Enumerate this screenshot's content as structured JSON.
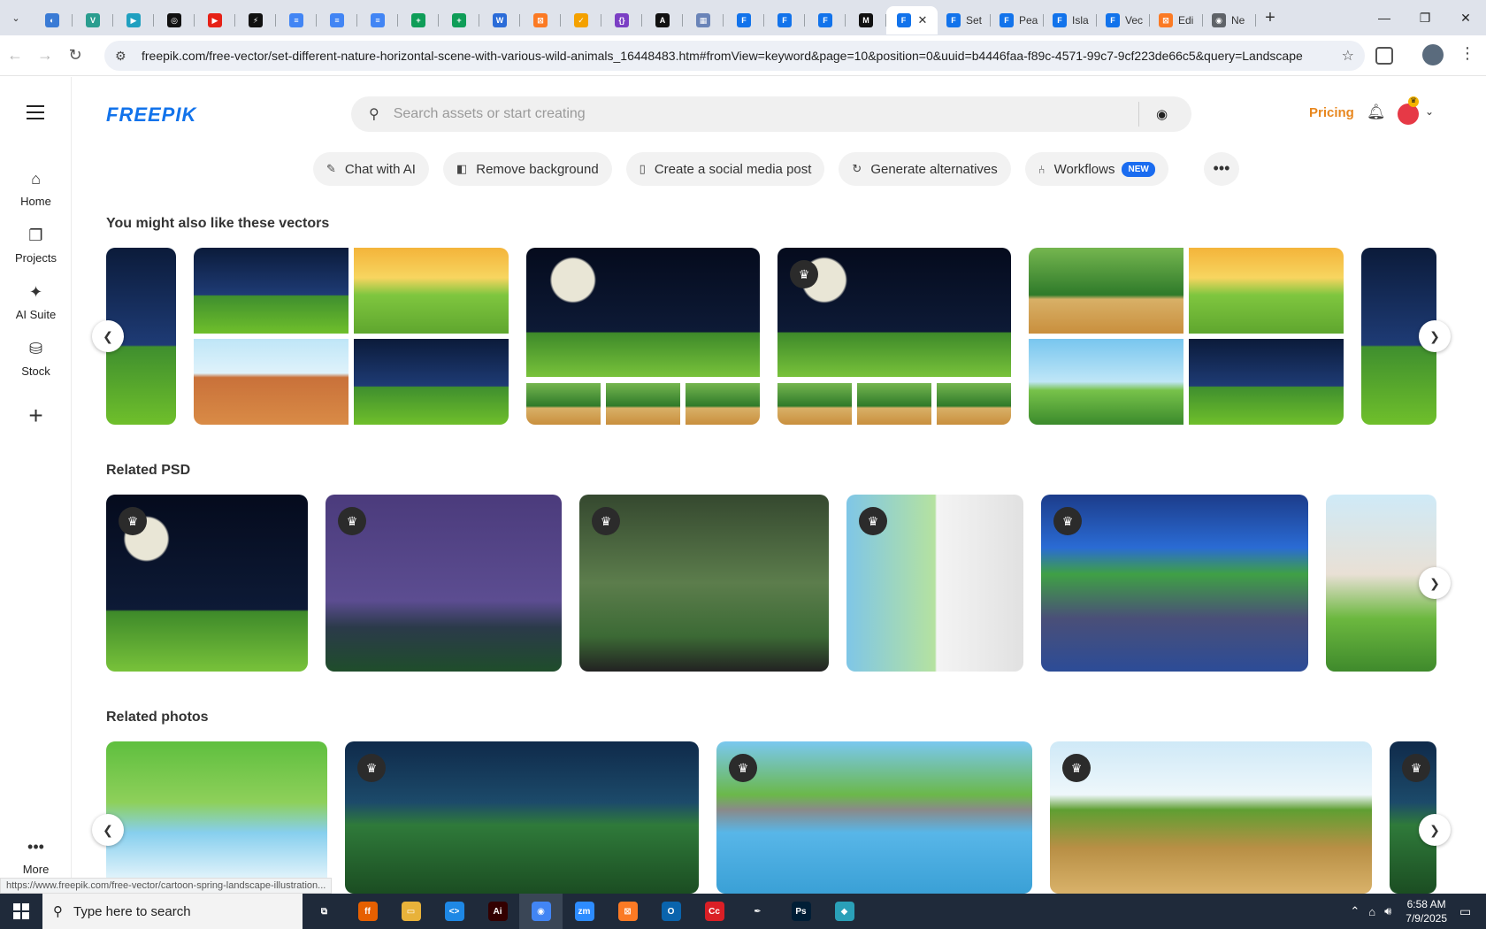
{
  "browser": {
    "tabs": [
      {
        "icon": "globe-icon",
        "color": "#3a7bd5",
        "letter": "◐"
      },
      {
        "icon": "v-icon",
        "color": "#2a9d8f",
        "letter": "V"
      },
      {
        "icon": "arrow-icon",
        "color": "#20a0c0",
        "letter": "▶"
      },
      {
        "icon": "openai-icon",
        "color": "#111111",
        "letter": "◎"
      },
      {
        "icon": "youtube-icon",
        "color": "#e62117",
        "letter": "▶"
      },
      {
        "icon": "bolt-icon",
        "color": "#111111",
        "letter": "⚡"
      },
      {
        "icon": "docs-icon",
        "color": "#4285f4",
        "letter": "≡"
      },
      {
        "icon": "docs-icon",
        "color": "#4285f4",
        "letter": "≡"
      },
      {
        "icon": "docs-icon",
        "color": "#4285f4",
        "letter": "≡"
      },
      {
        "icon": "sheets-icon",
        "color": "#0f9d58",
        "letter": "+"
      },
      {
        "icon": "sheets-icon",
        "color": "#0f9d58",
        "letter": "+"
      },
      {
        "icon": "word-icon",
        "color": "#2b6cd8",
        "letter": "W"
      },
      {
        "icon": "xampp-icon",
        "color": "#fb7a24",
        "letter": "⊠"
      },
      {
        "icon": "check-icon",
        "color": "#f4a100",
        "letter": "✓"
      },
      {
        "icon": "code-icon",
        "color": "#7b3fc4",
        "letter": "{}"
      },
      {
        "icon": "a-icon",
        "color": "#111111",
        "letter": "A"
      },
      {
        "icon": "grid-icon",
        "color": "#6a84b8",
        "letter": "▦"
      },
      {
        "icon": "freepik-icon",
        "color": "#1273eb",
        "letter": "F"
      },
      {
        "icon": "freepik-icon",
        "color": "#1273eb",
        "letter": "F"
      },
      {
        "icon": "freepik-icon",
        "color": "#1273eb",
        "letter": "F"
      },
      {
        "icon": "m-icon",
        "color": "#111111",
        "letter": "M"
      }
    ],
    "titled_tabs": [
      {
        "title": "Set",
        "color": "#1273eb",
        "letter": "F"
      },
      {
        "title": "Pea",
        "color": "#1273eb",
        "letter": "F"
      },
      {
        "title": "Isla",
        "color": "#1273eb",
        "letter": "F"
      },
      {
        "title": "Vec",
        "color": "#1273eb",
        "letter": "F"
      },
      {
        "title": "Edi",
        "color": "#fb7a24",
        "letter": "⊠"
      },
      {
        "title": "Ne",
        "color": "#5f6368",
        "letter": "◉"
      }
    ],
    "url": "freepik.com/free-vector/set-different-nature-horizontal-scene-with-various-wild-animals_16448483.htm#fromView=keyword&page=10&position=0&uuid=b4446faa-f89c-4571-99c7-9cf223de66c5&query=Landscape"
  },
  "sidebar": {
    "items": [
      {
        "label": "Home",
        "icon": "home-icon",
        "glyph": "⌂"
      },
      {
        "label": "Projects",
        "icon": "projects-icon",
        "glyph": "❐"
      },
      {
        "label": "AI Suite",
        "icon": "sparkle-icon",
        "glyph": "✦"
      },
      {
        "label": "Stock",
        "icon": "stock-icon",
        "glyph": "⛁"
      }
    ],
    "add_glyph": "+",
    "more_label": "More"
  },
  "header": {
    "logo": "FREEPIK",
    "search_placeholder": "Search assets or start creating",
    "pricing": "Pricing"
  },
  "tools": [
    {
      "label": "Chat with AI",
      "icon": "chat-edit-icon",
      "glyph": "✎"
    },
    {
      "label": "Remove background",
      "icon": "remove-bg-icon",
      "glyph": "◧"
    },
    {
      "label": "Create a social media post",
      "icon": "phone-icon",
      "glyph": "▯"
    },
    {
      "label": "Generate alternatives",
      "icon": "refresh-icon",
      "glyph": "↻"
    },
    {
      "label": "Workflows",
      "icon": "workflow-icon",
      "glyph": "⑃",
      "badge": "NEW"
    }
  ],
  "sections": {
    "vectors": "You might also like these vectors",
    "psd": "Related PSD",
    "photos": "Related photos"
  },
  "status_link": "https://www.freepik.com/free-vector/cartoon-spring-landscape-illustration...",
  "taskbar": {
    "search_placeholder": "Type here to search",
    "time": "6:58 AM",
    "date": "7/9/2025",
    "apps": [
      {
        "icon": "task-view-icon",
        "color": "#1f2a3a",
        "letter": "⧉"
      },
      {
        "icon": "firefox-icon",
        "color": "#e66000",
        "letter": "ff"
      },
      {
        "icon": "file-explorer-icon",
        "color": "#e8b23a",
        "letter": "▭"
      },
      {
        "icon": "vscode-icon",
        "color": "#1e88e5",
        "letter": "<>"
      },
      {
        "icon": "illustrator-icon",
        "color": "#330000",
        "letter": "Ai"
      },
      {
        "icon": "chrome-icon",
        "color": "#4285f4",
        "letter": "◉"
      },
      {
        "icon": "zoom-icon",
        "color": "#2d8cff",
        "letter": "zm"
      },
      {
        "icon": "xampp-icon",
        "color": "#fb7a24",
        "letter": "⊠"
      },
      {
        "icon": "outlook-icon",
        "color": "#0a64ad",
        "letter": "O"
      },
      {
        "icon": "creative-cloud-icon",
        "color": "#da1f26",
        "letter": "Cc"
      },
      {
        "icon": "pen-icon",
        "color": "#1f2a3a",
        "letter": "✒"
      },
      {
        "icon": "photoshop-icon",
        "color": "#001e36",
        "letter": "Ps"
      },
      {
        "icon": "app-icon",
        "color": "#2aa0b8",
        "letter": "◆"
      }
    ]
  }
}
